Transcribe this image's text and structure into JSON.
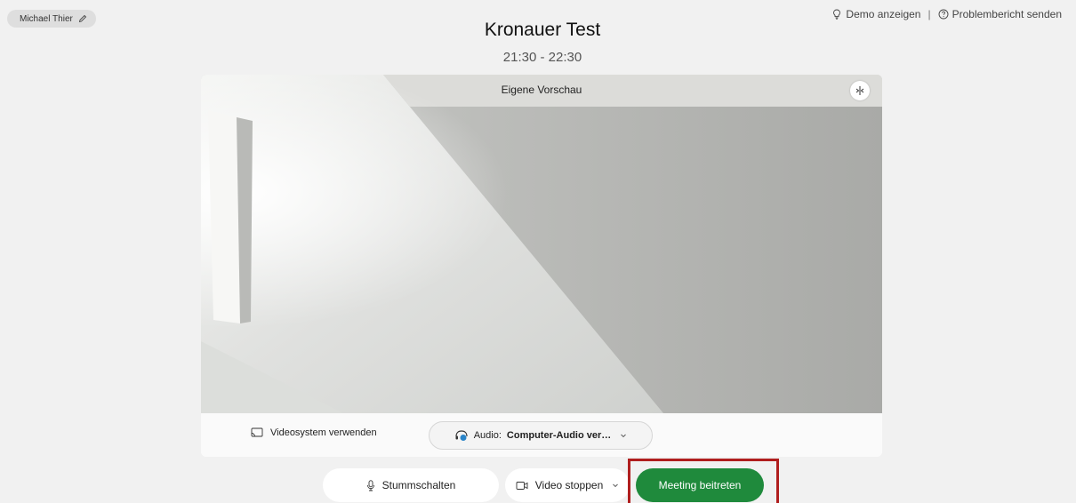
{
  "user": {
    "name": "Michael Thier",
    "icon": "pencil-icon"
  },
  "top_links": {
    "demo_label": "Demo anzeigen",
    "demo_icon": "lightbulb-icon",
    "separator": "|",
    "report_label": "Problembericht senden",
    "report_icon": "help-circle-icon"
  },
  "meeting": {
    "title": "Kronauer Test",
    "time": "21:30 - 22:30"
  },
  "preview": {
    "label": "Eigene Vorschau",
    "layout_icon": "layout-toggle-icon"
  },
  "footer": {
    "videosystem_label": "Videosystem verwenden",
    "videosystem_icon": "cast-icon",
    "audio_prefix": "Audio:",
    "audio_value": "Computer-Audio ver…",
    "audio_icon": "headset-icon"
  },
  "buttons": {
    "mute_label": "Stummschalten",
    "mute_icon": "microphone-icon",
    "video_label": "Video stoppen",
    "video_icon": "camera-icon",
    "join_label": "Meeting beitreten"
  },
  "colors": {
    "join_button": "#1f8a3c",
    "highlight_box": "#b01e1e",
    "background": "#f1f1f1"
  }
}
